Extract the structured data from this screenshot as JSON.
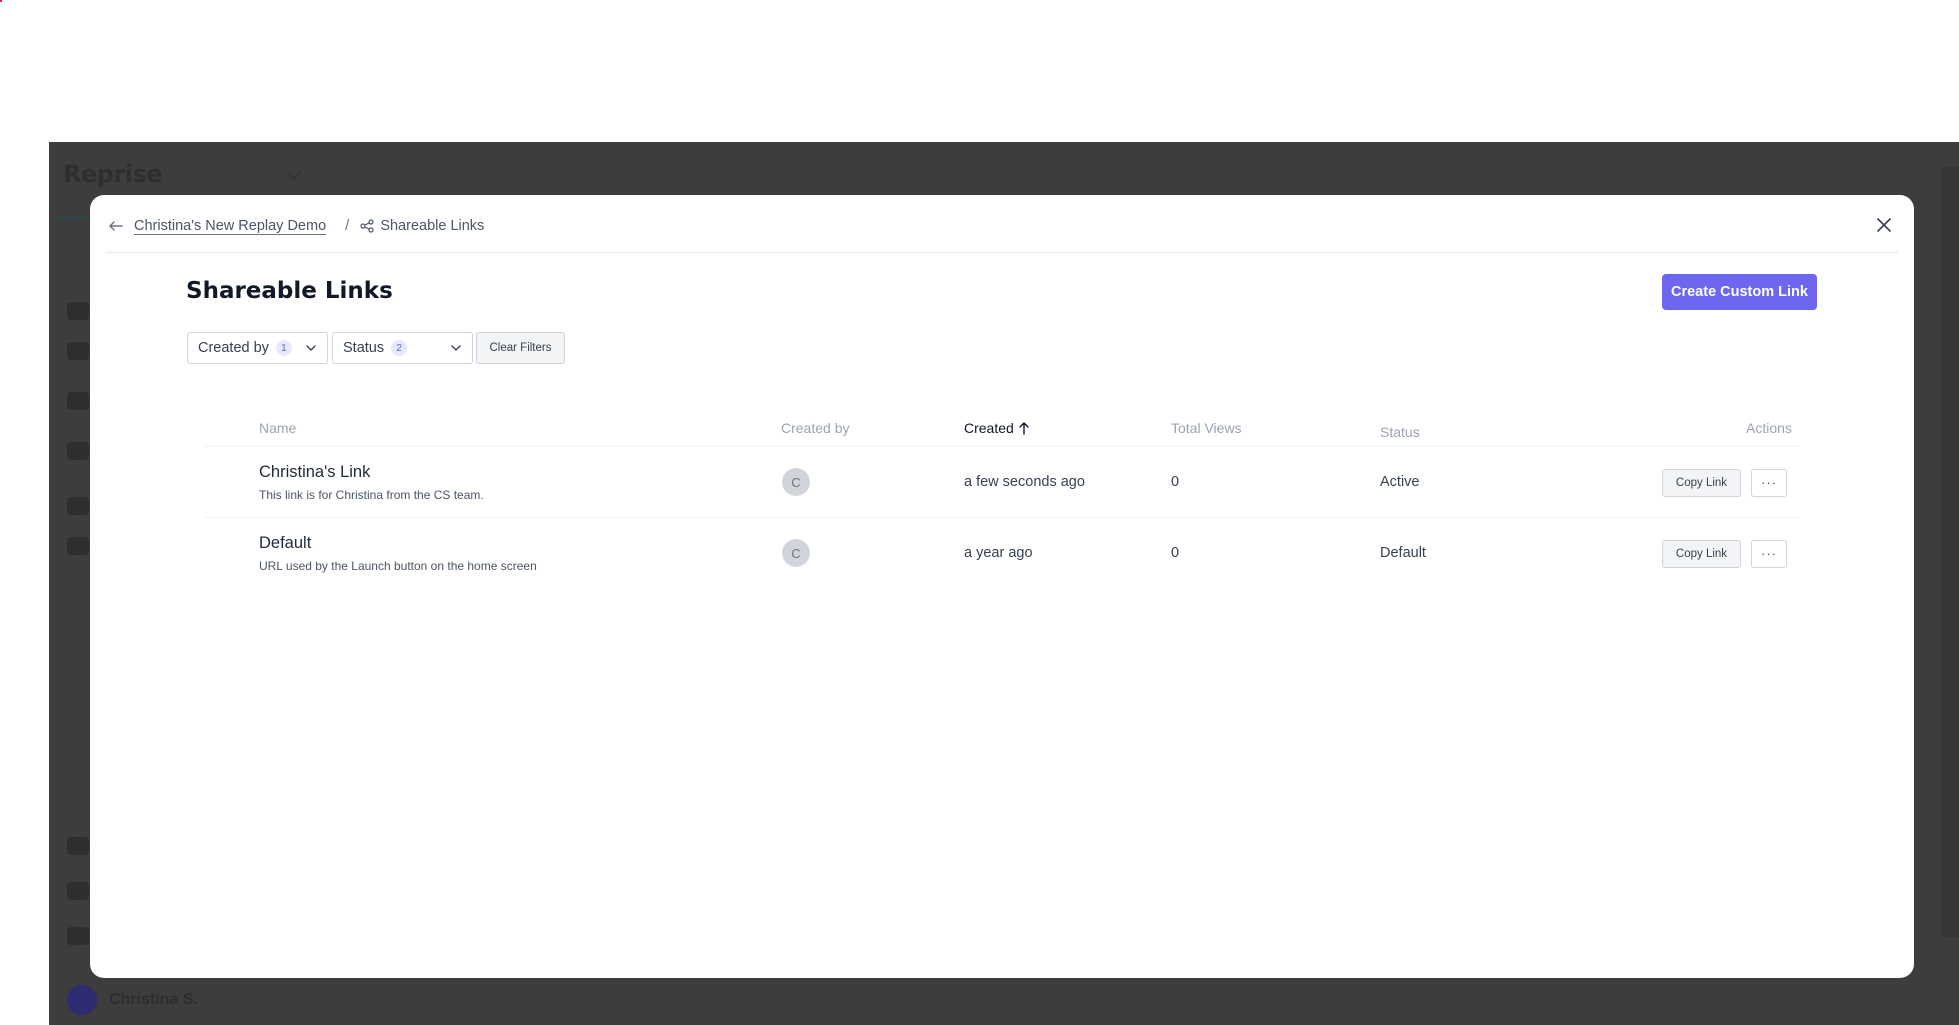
{
  "background": {
    "logo_text": "Reprise",
    "user_avatar_initial": "",
    "user_name": "Christina S."
  },
  "modal": {
    "breadcrumb": {
      "parent": "Christina's New Replay Demo",
      "separator": "/",
      "current": "Shareable Links"
    },
    "title": "Shareable Links",
    "create_button": "Create Custom Link",
    "filters": {
      "created_by": {
        "label": "Created by",
        "count": "1"
      },
      "status": {
        "label": "Status",
        "count": "2"
      },
      "clear_label": "Clear Filters"
    },
    "table": {
      "columns": {
        "name": "Name",
        "created_by": "Created by",
        "created": "Created",
        "total_views": "Total Views",
        "status": "Status",
        "actions": "Actions"
      },
      "rows": [
        {
          "name": "Christina's Link",
          "description": "This link is for Christina from the CS team.",
          "creator_initial": "C",
          "created": "a few seconds ago",
          "views": "0",
          "status": "Active",
          "copy_label": "Copy Link",
          "more_label": "···"
        },
        {
          "name": "Default",
          "description": "URL used by the Launch button on the home screen",
          "creator_initial": "C",
          "created": "a year ago",
          "views": "0",
          "status": "Default",
          "copy_label": "Copy Link",
          "more_label": "···"
        }
      ]
    }
  },
  "colors": {
    "accent": "#6d67f0",
    "backdrop": "#3d3d3d",
    "badge_bg": "#e8e8fb",
    "badge_text": "#6366f1"
  }
}
